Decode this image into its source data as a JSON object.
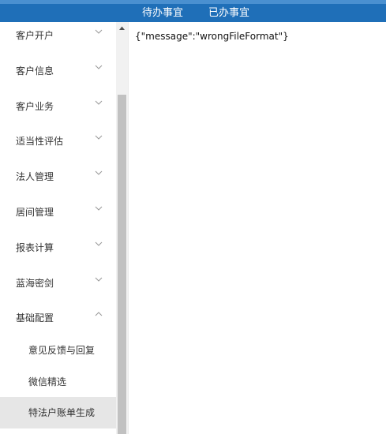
{
  "topbar": {
    "tabs": [
      {
        "label": "待办事宜"
      },
      {
        "label": "已办事宜"
      }
    ]
  },
  "sidebar": {
    "items": [
      {
        "label": "客户开户",
        "icon": "chevron-down-icon"
      },
      {
        "label": "客户信息",
        "icon": "chevron-down-icon"
      },
      {
        "label": "客户业务",
        "icon": "chevron-down-icon"
      },
      {
        "label": "适当性评估",
        "icon": "chevron-down-icon"
      },
      {
        "label": "法人管理",
        "icon": "chevron-down-icon"
      },
      {
        "label": "居间管理",
        "icon": "chevron-down-icon"
      },
      {
        "label": "报表计算",
        "icon": "chevron-down-icon"
      },
      {
        "label": "蓝海密剑",
        "icon": "chevron-down-icon"
      },
      {
        "label": "基础配置",
        "icon": "chevron-up-icon"
      }
    ],
    "subitems": [
      {
        "label": "意见反馈与回复"
      },
      {
        "label": "微信精选"
      },
      {
        "label": "特法户账单生成"
      }
    ]
  },
  "content": {
    "message": "{\"message\":\"wrongFileFormat\"}"
  },
  "colors": {
    "topbar": "#1f6fb8",
    "active_subitem": "#e6e6e6",
    "scroll_thumb": "#c1c1c1"
  }
}
